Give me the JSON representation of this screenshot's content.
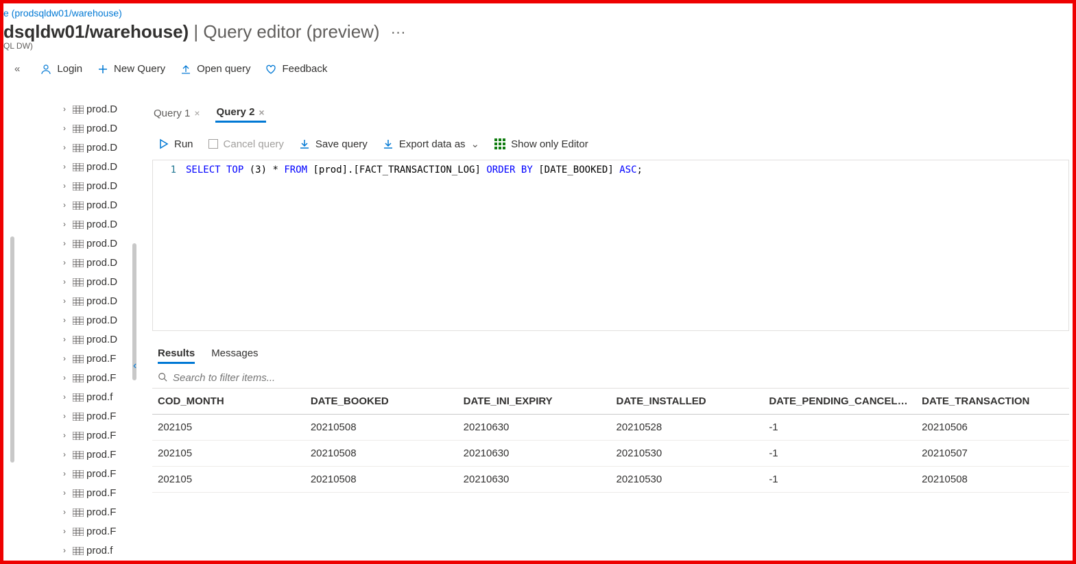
{
  "breadcrumb": {
    "link": "e (prodsqldw01/warehouse)"
  },
  "header": {
    "title_prefix": "dsqldw01/warehouse)",
    "title_suffix": " | Query editor (preview)",
    "subtitle": "QL DW)"
  },
  "topToolbar": {
    "collapse": "«",
    "login": "Login",
    "newQuery": "New Query",
    "openQuery": "Open query",
    "feedback": "Feedback"
  },
  "tree": {
    "items": [
      "prod.D",
      "prod.D",
      "prod.D",
      "prod.D",
      "prod.D",
      "prod.D",
      "prod.D",
      "prod.D",
      "prod.D",
      "prod.D",
      "prod.D",
      "prod.D",
      "prod.D",
      "prod.F",
      "prod.F",
      "prod.f",
      "prod.F",
      "prod.F",
      "prod.F",
      "prod.F",
      "prod.F",
      "prod.F",
      "prod.F",
      "prod.f"
    ]
  },
  "queryTabs": [
    {
      "label": "Query 1",
      "active": false
    },
    {
      "label": "Query 2",
      "active": true
    }
  ],
  "actions": {
    "run": "Run",
    "cancel": "Cancel query",
    "save": "Save query",
    "export": "Export data as",
    "showOnly": "Show only Editor"
  },
  "editor": {
    "lineNo": "1",
    "sql": {
      "p1": "SELECT",
      "p2": " TOP ",
      "p3": "(",
      "p4": "3",
      "p5": ") * ",
      "p6": "FROM",
      "p7": " [prod].[FACT_TRANSACTION_LOG] ",
      "p8": "ORDER BY",
      "p9": " [DATE_BOOKED] ",
      "p10": "ASC",
      "p11": ";"
    }
  },
  "resultsTabs": {
    "results": "Results",
    "messages": "Messages"
  },
  "search": {
    "placeholder": "Search to filter items..."
  },
  "table": {
    "columns": [
      "COD_MONTH",
      "DATE_BOOKED",
      "DATE_INI_EXPIRY",
      "DATE_INSTALLED",
      "DATE_PENDING_CANCELATIO...",
      "DATE_TRANSACTION"
    ],
    "rows": [
      [
        "202105",
        "20210508",
        "20210630",
        "20210528",
        "-1",
        "20210506"
      ],
      [
        "202105",
        "20210508",
        "20210630",
        "20210530",
        "-1",
        "20210507"
      ],
      [
        "202105",
        "20210508",
        "20210630",
        "20210530",
        "-1",
        "20210508"
      ]
    ]
  }
}
